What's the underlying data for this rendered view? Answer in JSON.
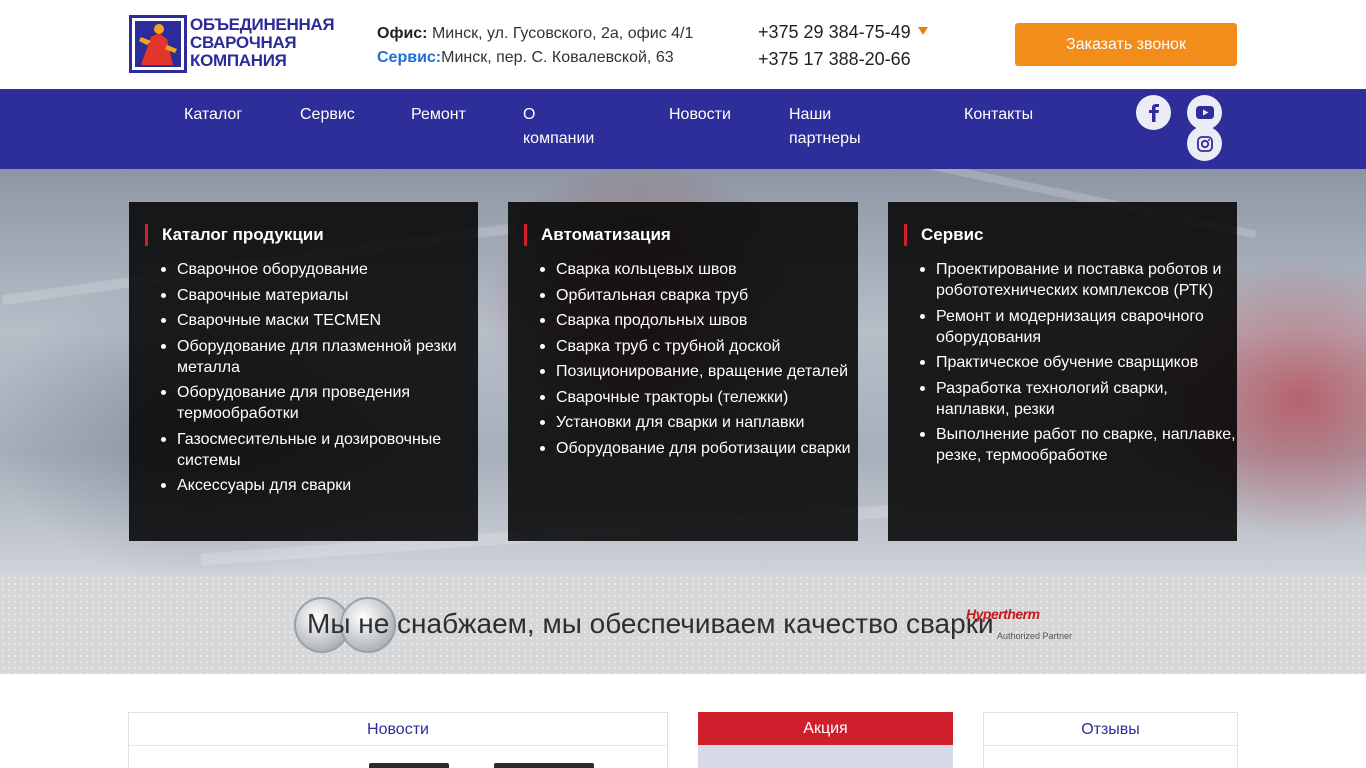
{
  "header": {
    "logo": {
      "line1": "ОБЪЕДИНЕННАЯ",
      "line2": "СВАРОЧНАЯ",
      "line3": "КОМПАНИЯ"
    },
    "office_label": "Офис:",
    "office_address": "Минск, ул. Гусовского, 2а, офис 4/1",
    "service_label": "Сервис:",
    "service_address": "Минск, пер. С. Ковалевской, 63",
    "phone1": "+375 29 384-75-49",
    "phone2": "+375 17 388-20-66",
    "call_button": "Заказать звонок",
    "accent_color": "#f28c1a"
  },
  "nav": {
    "items": [
      {
        "label": "Каталог"
      },
      {
        "label": "Сервис"
      },
      {
        "label": "Ремонт"
      },
      {
        "label_line1": "О",
        "label_line2": "компании"
      },
      {
        "label": "Новости"
      },
      {
        "label_line1": "Наши",
        "label_line2": "партнеры"
      },
      {
        "label": "Контакты"
      }
    ],
    "social": [
      "facebook-icon",
      "youtube-icon",
      "instagram-icon"
    ],
    "bg_color": "#2e2e9a"
  },
  "panels": [
    {
      "title": "Каталог продукции",
      "items": [
        "Сварочное оборудование",
        "Сварочные материалы",
        "Сварочные маски TECMEN",
        "Оборудование для плазменной резки металла",
        "Оборудование для проведения термообработки",
        "Газосмесительные и дозировочные системы",
        "Аксессуары для сварки"
      ]
    },
    {
      "title": "Автоматизация",
      "items": [
        "Сварка кольцевых швов",
        "Орбитальная сварка труб",
        "Сварка продольных швов",
        "Сварка труб с трубной доской",
        "Позиционирование, вращение деталей",
        "Сварочные тракторы (тележки)",
        "Установки для сварки и наплавки",
        "Оборудование для роботизации сварки"
      ]
    },
    {
      "title": "Сервис",
      "items": [
        "Проектирование и поставка роботов и робототехнических комплексов (РТК)",
        "Ремонт и модернизация сварочного оборудования",
        "Практическое обучение сварщиков",
        "Разработка технологий сварки, наплавки, резки",
        "Выполнение работ по сварке, наплавке, резке, термообработке"
      ]
    }
  ],
  "slogan": {
    "text": "Мы не снабжаем, мы обеспечиваем качество сварки",
    "partner_logo": "Hypertherm",
    "partner_sub": "Authorized Partner"
  },
  "cards": {
    "news": "Новости",
    "promo": "Акция",
    "reviews": "Отзывы"
  },
  "colors": {
    "brand_blue": "#2e2e9a",
    "accent_red": "#d31f2b",
    "service_link": "#1e6fd9"
  }
}
